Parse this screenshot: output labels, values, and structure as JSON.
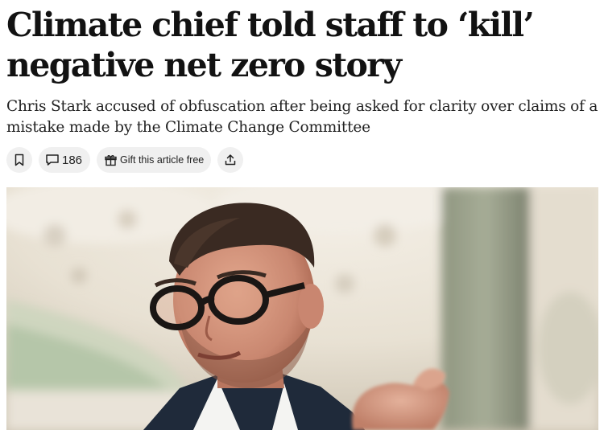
{
  "article": {
    "headline": "Climate chief told staff to ‘kill’ negative net zero story",
    "standfirst": "Chris Stark accused of obfuscation after being asked for clarity over claims of a mistake made by the Climate Change Committee"
  },
  "toolbar": {
    "bookmark_icon": "bookmark-icon",
    "comment_icon": "comment-icon",
    "comment_count": "186",
    "gift_icon": "gift-icon",
    "gift_label": "Gift this article free",
    "share_icon": "share-icon"
  },
  "image": {
    "subject": "photo-of-man-with-glasses"
  },
  "colors": {
    "text": "#121212",
    "pill_background": "#f0f0f0"
  }
}
